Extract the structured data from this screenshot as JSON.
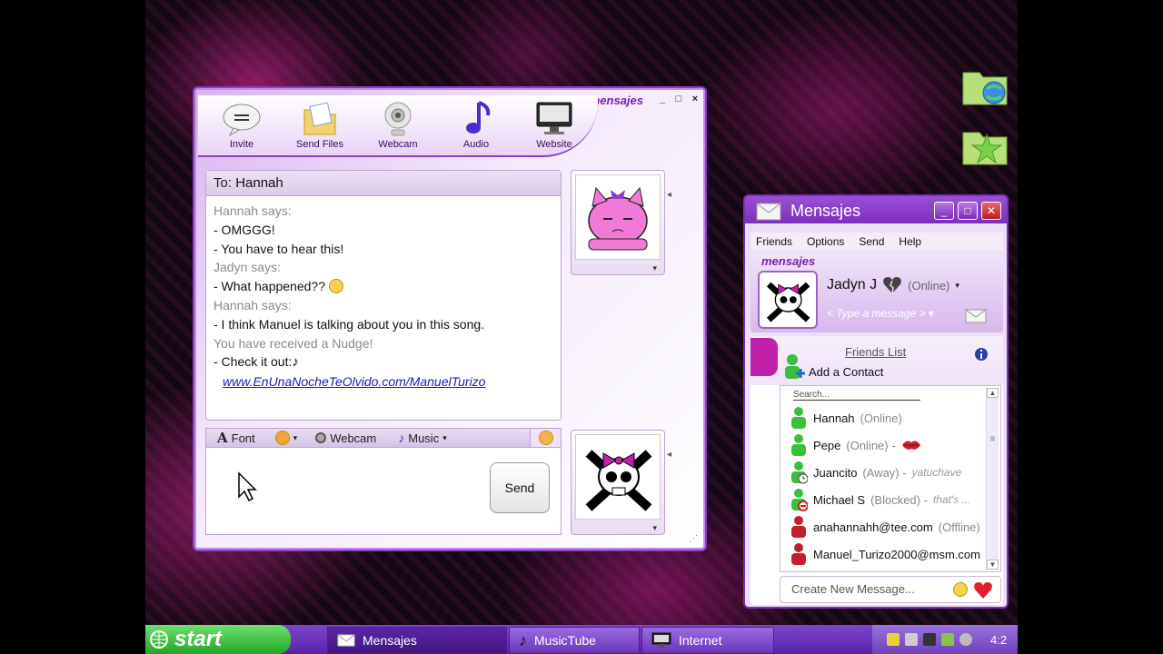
{
  "chat_window": {
    "brand": "mensajes",
    "controls": {
      "minimize": "_",
      "maximize": "□",
      "close": "×"
    },
    "toolbar": [
      {
        "label": "Invite",
        "icon": "speech-bubble-icon"
      },
      {
        "label": "Send Files",
        "icon": "folder-icon"
      },
      {
        "label": "Webcam",
        "icon": "webcam-icon"
      },
      {
        "label": "Audio",
        "icon": "music-note-icon"
      },
      {
        "label": "Website",
        "icon": "monitor-icon"
      }
    ],
    "to_label": "To:",
    "to_name": "Hannah",
    "messages": [
      {
        "type": "says",
        "text": "Hannah says:"
      },
      {
        "type": "line",
        "text": "- OMGGG!"
      },
      {
        "type": "line",
        "text": "- You have to hear this!"
      },
      {
        "type": "says",
        "text": "Jadyn says:"
      },
      {
        "type": "line",
        "text": "- What happened??"
      },
      {
        "type": "says",
        "text": "Hannah says:"
      },
      {
        "type": "line",
        "text": "- I think Manuel is talking about you in this song."
      },
      {
        "type": "nudge",
        "text": "You have received a Nudge!"
      },
      {
        "type": "line",
        "text": "- Check it out:"
      },
      {
        "type": "link",
        "text": "www.EnUnaNocheTeOlvido.com/ManuelTurizo"
      }
    ],
    "compose_toolbar": {
      "font": "Font",
      "webcam": "Webcam",
      "music": "Music"
    },
    "send_label": "Send"
  },
  "main_window": {
    "title": "Mensajes",
    "controls": {
      "minimize": "_",
      "maximize": "□",
      "close": "✕"
    },
    "menu": [
      "Friends",
      "Options",
      "Send",
      "Help"
    ],
    "brand": "mensajes",
    "user_name": "Jadyn J",
    "user_status": "(Online)",
    "personal_message_placeholder": "< Type a message >",
    "friends_list_title": "Friends List",
    "add_contact": "Add a Contact",
    "search_placeholder": "Search...",
    "friends": [
      {
        "name": "Hannah",
        "status": "(Online)",
        "message": "",
        "color": "#3bbf3b"
      },
      {
        "name": "Pepe",
        "status": "(Online) -",
        "message": "",
        "color": "#3bbf3b"
      },
      {
        "name": "Juancito",
        "status": "(Away) -",
        "message": "yatuchave",
        "color": "#3bbf3b"
      },
      {
        "name": "Michael S",
        "status": "(Blocked) -",
        "message": "that's ...",
        "color": "#3bbf3b"
      },
      {
        "name": "anahannahh@tee.com",
        "status": "(Offline)",
        "message": "",
        "color": "#c81c2a"
      },
      {
        "name": "Manuel_Turizo2000@msm.com",
        "status": "",
        "message": "",
        "color": "#c81c2a"
      }
    ],
    "create_message": "Create New Message..."
  },
  "taskbar": {
    "start": "start",
    "tasks": [
      {
        "label": "Mensajes",
        "icon": "envelope-icon"
      },
      {
        "label": "MusicTube",
        "icon": "music-note-icon"
      },
      {
        "label": "Internet",
        "icon": "monitor-icon"
      }
    ],
    "clock": "4:2"
  }
}
